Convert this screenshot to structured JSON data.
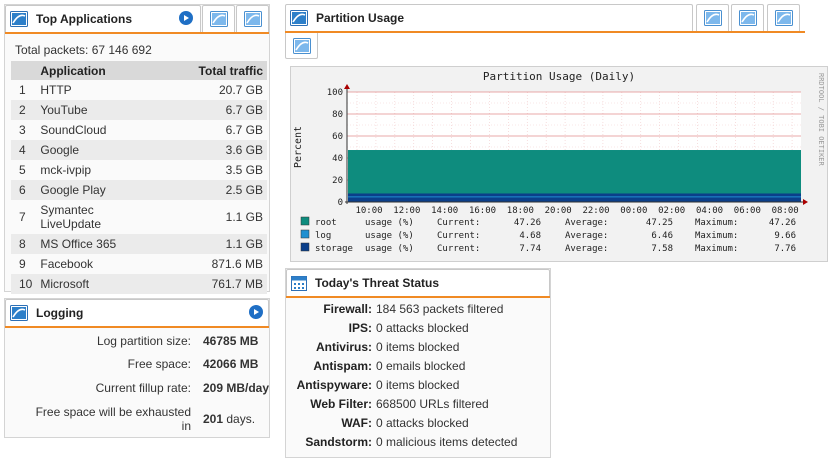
{
  "top_apps": {
    "title": "Top Applications",
    "total_packets": "Total packets: 67 146 692",
    "col_application": "Application",
    "col_total": "Total traffic",
    "rows": [
      {
        "n": "1",
        "app": "HTTP",
        "traffic": "20.7 GB"
      },
      {
        "n": "2",
        "app": "YouTube",
        "traffic": "6.7 GB"
      },
      {
        "n": "3",
        "app": "SoundCloud",
        "traffic": "6.7 GB"
      },
      {
        "n": "4",
        "app": "Google",
        "traffic": "3.6 GB"
      },
      {
        "n": "5",
        "app": "mck-ivpip",
        "traffic": "3.5 GB"
      },
      {
        "n": "6",
        "app": "Google Play",
        "traffic": "2.5 GB"
      },
      {
        "n": "7",
        "app": "Symantec LiveUpdate",
        "traffic": "1.1 GB"
      },
      {
        "n": "8",
        "app": "MS Office 365",
        "traffic": "1.1 GB"
      },
      {
        "n": "9",
        "app": "Facebook",
        "traffic": "871.6 MB"
      },
      {
        "n": "10",
        "app": "Microsoft",
        "traffic": "761.7 MB"
      }
    ]
  },
  "logging": {
    "title": "Logging",
    "partition_label": "Log partition size:",
    "partition_value": "46785 MB",
    "free_label": "Free space:",
    "free_value": "42066 MB",
    "fillup_label": "Current fillup rate:",
    "fillup_value": "209 MB/day",
    "exhaust_label_1": "Free space will be exhausted",
    "exhaust_label_2": "in",
    "exhaust_value": "201",
    "exhaust_unit": "days."
  },
  "partition": {
    "title": "Partition Usage"
  },
  "chart_data": {
    "type": "area",
    "title": "Partition Usage (Daily)",
    "ylabel": "Percent",
    "side_label": "RRDTOOL / TOBI OETIKER",
    "ylim": [
      0,
      100
    ],
    "yticks": [
      "0",
      "20",
      "40",
      "60",
      "80",
      "100"
    ],
    "x_ticks": [
      "10:00",
      "12:00",
      "14:00",
      "16:00",
      "18:00",
      "20:00",
      "22:00",
      "00:00",
      "02:00",
      "04:00",
      "06:00",
      "08:00"
    ],
    "series": [
      {
        "name": "root",
        "color": "#0e8c7e",
        "unit": "usage (%)",
        "current_label": "Current:",
        "current": "47.26",
        "average_label": "Average:",
        "average": "47.25",
        "maximum_label": "Maximum:",
        "maximum": "47.26"
      },
      {
        "name": "log",
        "color": "#1f8fd0",
        "unit": "usage (%)",
        "current_label": "Current:",
        "current": "4.68",
        "average_label": "Average:",
        "average": "6.46",
        "maximum_label": "Maximum:",
        "maximum": "9.66"
      },
      {
        "name": "storage",
        "color": "#0b3f8a",
        "unit": "usage (%)",
        "current_label": "Current:",
        "current": "7.74",
        "average_label": "Average:",
        "average": "7.58",
        "maximum_label": "Maximum:",
        "maximum": "7.76"
      }
    ]
  },
  "threat": {
    "title": "Today's Threat Status",
    "rows": [
      {
        "label": "Firewall:",
        "value": "184 563 packets filtered"
      },
      {
        "label": "IPS:",
        "value": "0 attacks blocked"
      },
      {
        "label": "Antivirus:",
        "value": "0 items blocked"
      },
      {
        "label": "Antispam:",
        "value": "0 emails blocked"
      },
      {
        "label": "Antispyware:",
        "value": "0 items blocked"
      },
      {
        "label": "Web Filter:",
        "value": "668500 URLs filtered"
      },
      {
        "label": "WAF:",
        "value": "0 attacks blocked"
      },
      {
        "label": "Sandstorm:",
        "value": "0 malicious items detected"
      }
    ]
  },
  "colors": {
    "accent": "#f08a24",
    "play": "#1f6fc5"
  }
}
